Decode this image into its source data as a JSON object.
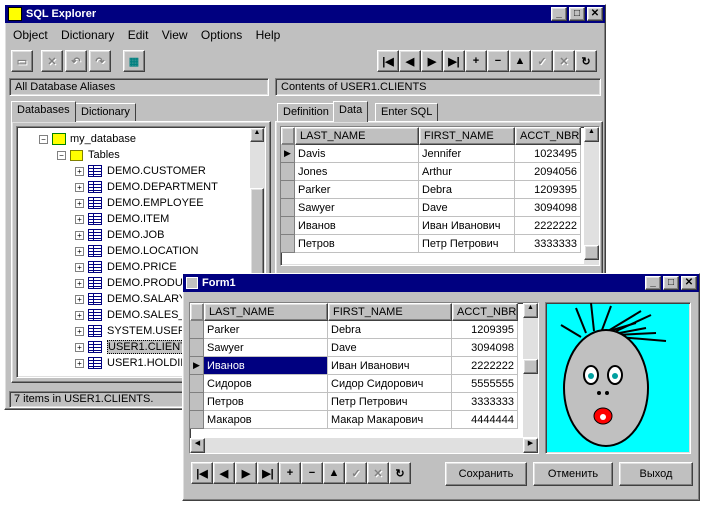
{
  "main_window": {
    "title": "SQL Explorer",
    "menu": [
      "Object",
      "Dictionary",
      "Edit",
      "View",
      "Options",
      "Help"
    ],
    "left_panel_label": "All Database Aliases",
    "right_panel_label": "Contents of USER1.CLIENTS",
    "left_tabs": [
      "Databases",
      "Dictionary"
    ],
    "right_tabs": [
      "Definition",
      "Data",
      "Enter SQL"
    ],
    "active_left_tab": "Databases",
    "active_right_tab": "Data",
    "tree": {
      "database": "my_database",
      "tables_label": "Tables",
      "items": [
        "DEMO.CUSTOMER",
        "DEMO.DEPARTMENT",
        "DEMO.EMPLOYEE",
        "DEMO.ITEM",
        "DEMO.JOB",
        "DEMO.LOCATION",
        "DEMO.PRICE",
        "DEMO.PRODUCT",
        "DEMO.SALARY",
        "DEMO.SALES_",
        "SYSTEM.USER",
        "USER1.CLIENT",
        "USER1.HOLDIN"
      ],
      "selected": "USER1.CLIENT"
    },
    "status": "7 items in USER1.CLIENTS.",
    "grid": {
      "columns": [
        "LAST_NAME",
        "FIRST_NAME",
        "ACCT_NBR"
      ],
      "rows": [
        [
          "Davis",
          "Jennifer",
          "1023495"
        ],
        [
          "Jones",
          "Arthur",
          "2094056"
        ],
        [
          "Parker",
          "Debra",
          "1209395"
        ],
        [
          "Sawyer",
          "Dave",
          "3094098"
        ],
        [
          "Иванов",
          "Иван Иванович",
          "2222222"
        ],
        [
          "Петров",
          "Петр Петрович",
          "3333333"
        ]
      ]
    }
  },
  "form1": {
    "title": "Form1",
    "grid": {
      "columns": [
        "LAST_NAME",
        "FIRST_NAME",
        "ACCT_NBR"
      ],
      "rows": [
        [
          "Parker",
          "Debra",
          "1209395"
        ],
        [
          "Sawyer",
          "Dave",
          "3094098"
        ],
        [
          "Иванов",
          "Иван Иванович",
          "2222222"
        ],
        [
          "Сидоров",
          "Сидор Сидорович",
          "5555555"
        ],
        [
          "Петров",
          "Петр Петрович",
          "3333333"
        ],
        [
          "Макаров",
          "Макар Макарович",
          "4444444"
        ]
      ]
    },
    "buttons": {
      "save": "Сохранить",
      "cancel": "Отменить",
      "exit": "Выход"
    }
  },
  "colors": {
    "title_bar": "#000080",
    "face_bg": "#00ffff",
    "face": "#c0c0c0"
  }
}
